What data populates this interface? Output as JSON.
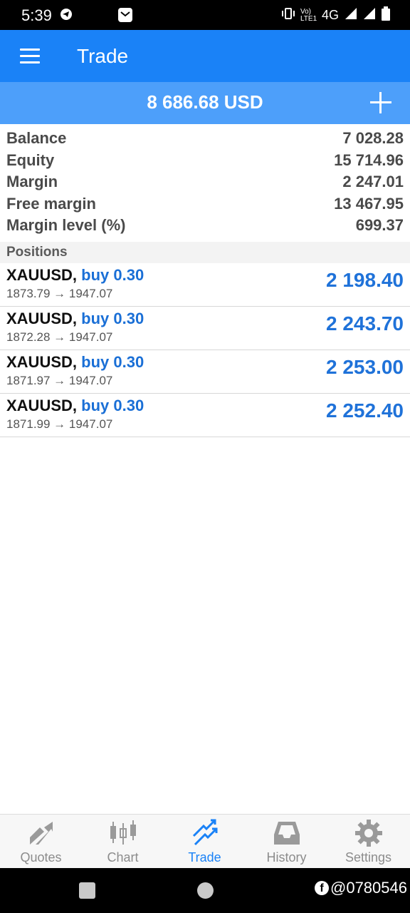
{
  "status_bar": {
    "time": "5:39",
    "network": "4G",
    "volte": "Vo) LTE1"
  },
  "app_bar": {
    "title": "Trade",
    "menu_icon": "hamburger-menu-icon"
  },
  "account": {
    "total": "8 686.68 USD",
    "add_icon": "plus-icon"
  },
  "summary": [
    {
      "label": "Balance",
      "value": "7 028.28"
    },
    {
      "label": "Equity",
      "value": "15 714.96"
    },
    {
      "label": "Margin",
      "value": "2 247.01"
    },
    {
      "label": "Free margin",
      "value": "13 467.95"
    },
    {
      "label": "Margin level (%)",
      "value": "699.37"
    }
  ],
  "positions_header": "Positions",
  "positions": [
    {
      "symbol": "XAUUSD",
      "type": "buy 0.30",
      "prices": "1873.79 → 1947.07",
      "profit": "2 198.40"
    },
    {
      "symbol": "XAUUSD",
      "type": "buy 0.30",
      "prices": "1872.28 → 1947.07",
      "profit": "2 243.70"
    },
    {
      "symbol": "XAUUSD",
      "type": "buy 0.30",
      "prices": "1871.97 → 1947.07",
      "profit": "2 253.00"
    },
    {
      "symbol": "XAUUSD",
      "type": "buy 0.30",
      "prices": "1871.99 → 1947.07",
      "profit": "2 252.40"
    }
  ],
  "bottom_nav": {
    "items": [
      {
        "label": "Quotes",
        "icon": "quotes-icon"
      },
      {
        "label": "Chart",
        "icon": "candlestick-chart-icon"
      },
      {
        "label": "Trade",
        "icon": "trade-icon",
        "active": true
      },
      {
        "label": "History",
        "icon": "inbox-tray-icon"
      },
      {
        "label": "Settings",
        "icon": "gear-icon"
      }
    ]
  },
  "watermark": "@0780546",
  "colors": {
    "app_bar": "#1a82f7",
    "account_bar": "#4d9ffa",
    "profit": "#1f72d9",
    "nav_active": "#1a82f7",
    "nav_inactive": "#8c8c8c"
  }
}
